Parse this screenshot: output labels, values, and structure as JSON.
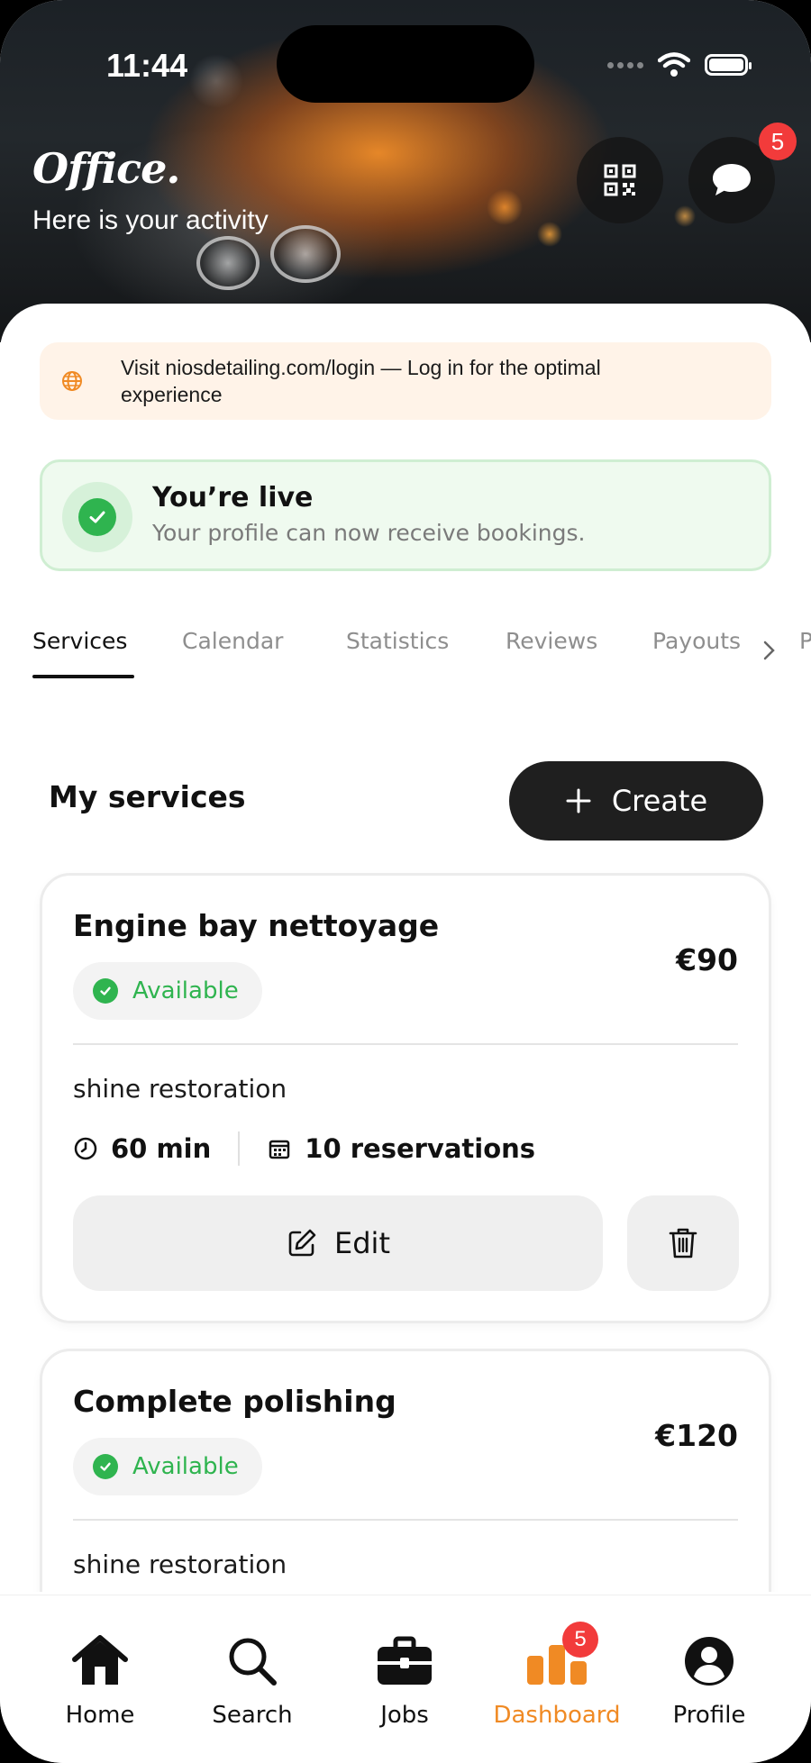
{
  "status_bar": {
    "time": "11:44"
  },
  "header": {
    "brand": "Office.",
    "subtitle": "Here is your activity",
    "chat_badge": "5"
  },
  "notice": {
    "text": "Visit niosdetailing.com/login — Log in for the optimal experience"
  },
  "live_banner": {
    "title": "You’re live",
    "subtitle": "Your profile can now receive bookings."
  },
  "tabs": [
    {
      "label": "Services",
      "active": true
    },
    {
      "label": "Calendar",
      "active": false
    },
    {
      "label": "Statistics",
      "active": false
    },
    {
      "label": "Reviews",
      "active": false
    },
    {
      "label": "Payouts",
      "active": false
    },
    {
      "label": "P",
      "active": false
    }
  ],
  "services_section": {
    "title": "My services",
    "create_label": "Create"
  },
  "services": [
    {
      "name": "Engine bay nettoyage",
      "price": "€90",
      "status": "Available",
      "description": "shine restoration",
      "duration": "60 min",
      "reservations": "10 reservations",
      "edit_label": "Edit"
    },
    {
      "name": "Complete polishing",
      "price": "€120",
      "status": "Available",
      "description": "shine restoration"
    }
  ],
  "bottom_nav": {
    "items": [
      {
        "label": "Home",
        "icon": "home-icon"
      },
      {
        "label": "Search",
        "icon": "search-icon"
      },
      {
        "label": "Jobs",
        "icon": "briefcase-icon"
      },
      {
        "label": "Dashboard",
        "icon": "bar-chart-icon",
        "active": true
      },
      {
        "label": "Profile",
        "icon": "user-icon"
      }
    ],
    "dashboard_badge": "5"
  },
  "colors": {
    "accent": "#f08a24",
    "success": "#2fb44f",
    "badge": "#f23b3b",
    "notice_bg": "#fff3e8",
    "live_bg": "#effaef"
  }
}
